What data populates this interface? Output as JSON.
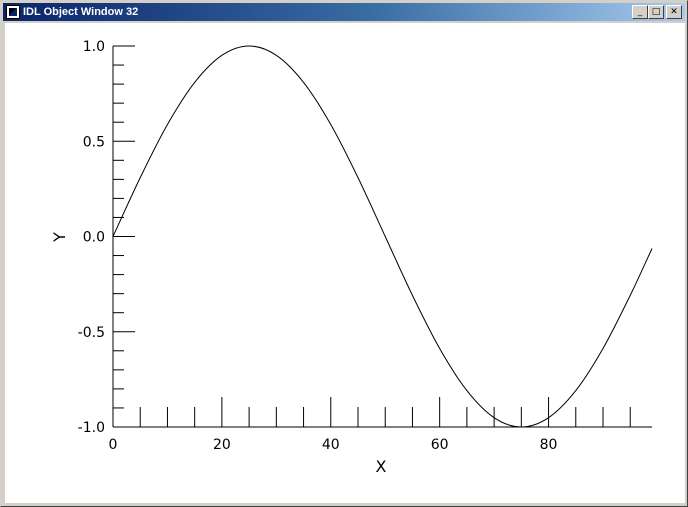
{
  "window": {
    "title": "IDL Object Window 32"
  },
  "title_buttons": {
    "minimize_glyph": "_",
    "maximize_glyph": "□",
    "close_glyph": "✕"
  },
  "chart_data": {
    "type": "line",
    "function": "sin(2*pi*x/100)",
    "x": [
      0,
      5,
      10,
      15,
      20,
      25,
      30,
      35,
      40,
      45,
      50,
      55,
      60,
      65,
      70,
      75,
      80,
      85,
      90,
      95,
      99
    ],
    "y": [
      0.0,
      0.309,
      0.588,
      0.809,
      0.951,
      1.0,
      0.951,
      0.809,
      0.588,
      0.309,
      0.0,
      -0.309,
      -0.588,
      -0.809,
      -0.951,
      -1.0,
      -0.951,
      -0.809,
      -0.588,
      -0.309,
      -0.063
    ],
    "xlabel": "X",
    "ylabel": "Y",
    "xlim": [
      0,
      99
    ],
    "ylim": [
      -1.0,
      1.0
    ],
    "x_major_ticks": [
      0,
      20,
      40,
      60,
      80
    ],
    "x_tick_labels": [
      "0",
      "20",
      "40",
      "60",
      "80"
    ],
    "y_major_ticks": [
      -1.0,
      -0.5,
      0.0,
      0.5,
      1.0
    ],
    "y_tick_labels": [
      "-1.0",
      "-0.5",
      "0.0",
      "0.5",
      "1.0"
    ],
    "grid": false,
    "line_color": "#000000"
  }
}
